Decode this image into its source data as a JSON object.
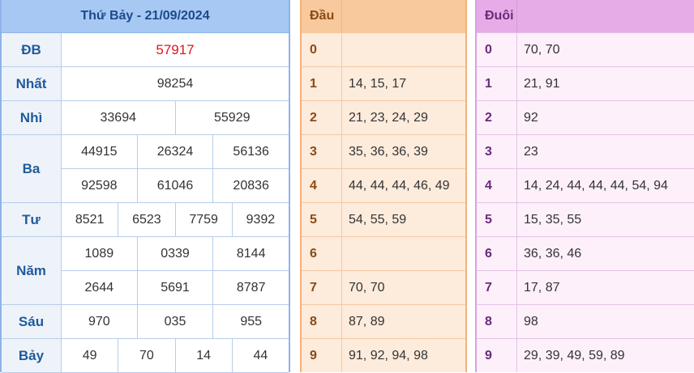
{
  "results": {
    "title": "Thứ Bảy - 21/09/2024",
    "prizes": [
      {
        "label": "ĐB",
        "lines": [
          [
            "57917"
          ]
        ],
        "special": true
      },
      {
        "label": "Nhất",
        "lines": [
          [
            "98254"
          ]
        ]
      },
      {
        "label": "Nhì",
        "lines": [
          [
            "33694",
            "55929"
          ]
        ]
      },
      {
        "label": "Ba",
        "lines": [
          [
            "44915",
            "26324",
            "56136"
          ],
          [
            "92598",
            "61046",
            "20836"
          ]
        ]
      },
      {
        "label": "Tư",
        "lines": [
          [
            "8521",
            "6523",
            "7759",
            "9392"
          ]
        ]
      },
      {
        "label": "Năm",
        "lines": [
          [
            "1089",
            "0339",
            "8144"
          ],
          [
            "2644",
            "5691",
            "8787"
          ]
        ]
      },
      {
        "label": "Sáu",
        "lines": [
          [
            "970",
            "035",
            "955"
          ]
        ]
      },
      {
        "label": "Bảy",
        "lines": [
          [
            "49",
            "70",
            "14",
            "44"
          ]
        ]
      }
    ]
  },
  "dau": {
    "header": "Đầu",
    "rows": [
      {
        "digit": "0",
        "values": ""
      },
      {
        "digit": "1",
        "values": "14, 15, 17"
      },
      {
        "digit": "2",
        "values": "21, 23, 24, 29"
      },
      {
        "digit": "3",
        "values": "35, 36, 36, 39"
      },
      {
        "digit": "4",
        "values": "44, 44, 44, 46, 49"
      },
      {
        "digit": "5",
        "values": "54, 55, 59"
      },
      {
        "digit": "6",
        "values": ""
      },
      {
        "digit": "7",
        "values": "70, 70"
      },
      {
        "digit": "8",
        "values": "87, 89"
      },
      {
        "digit": "9",
        "values": "91, 92, 94, 98"
      }
    ]
  },
  "duoi": {
    "header": "Đuôi",
    "rows": [
      {
        "digit": "0",
        "values": "70, 70"
      },
      {
        "digit": "1",
        "values": "21, 91"
      },
      {
        "digit": "2",
        "values": "92"
      },
      {
        "digit": "3",
        "values": "23"
      },
      {
        "digit": "4",
        "values": "14, 24, 44, 44, 44, 54, 94"
      },
      {
        "digit": "5",
        "values": "15, 35, 55"
      },
      {
        "digit": "6",
        "values": "36, 36, 46"
      },
      {
        "digit": "7",
        "values": "17, 87"
      },
      {
        "digit": "8",
        "values": "98"
      },
      {
        "digit": "9",
        "values": "29, 39, 49, 59, 89"
      }
    ]
  }
}
